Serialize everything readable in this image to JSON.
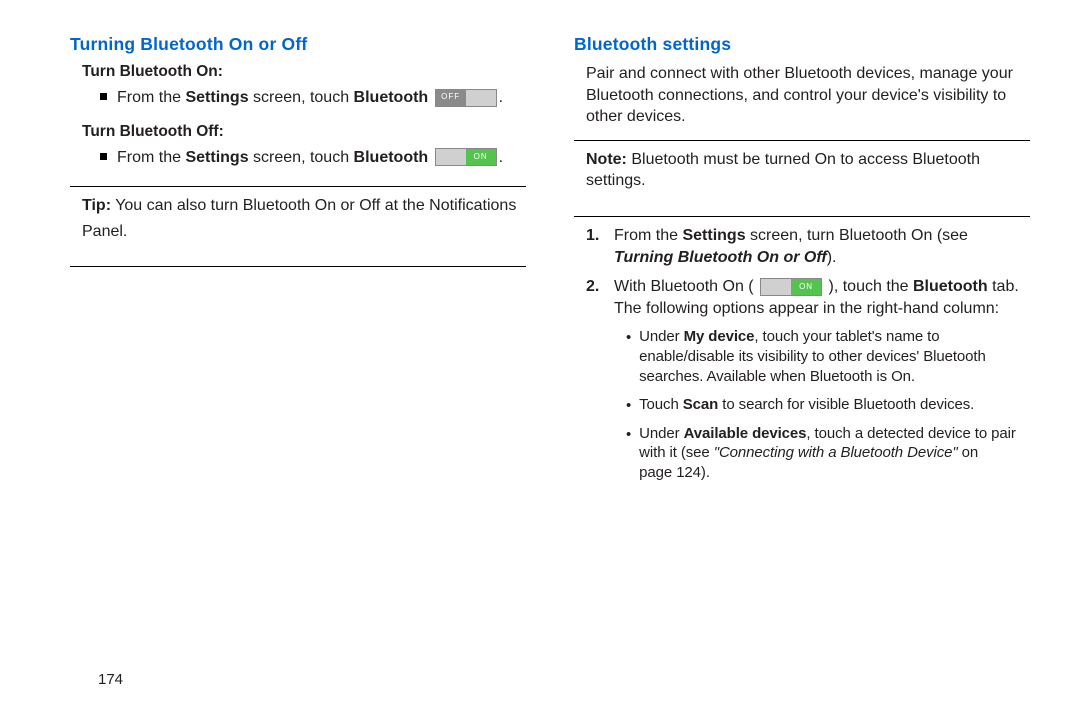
{
  "pageNumber": "174",
  "left": {
    "heading": "Turning Bluetooth On or Off",
    "turnOn": {
      "label": "Turn Bluetooth On:",
      "prefix": "From the ",
      "settings": "Settings",
      "mid": " screen, touch ",
      "bluetooth": "Bluetooth",
      "toggleLabel": "OFF",
      "period": "."
    },
    "turnOff": {
      "label": "Turn Bluetooth Off:",
      "prefix": "From the ",
      "settings": "Settings",
      "mid": " screen, touch ",
      "bluetooth": "Bluetooth",
      "toggleLabel": "ON",
      "period": "."
    },
    "tip": {
      "label": "Tip:",
      "textLine1": " You can also turn Bluetooth On or Off at the Notifications",
      "textLine2": "Panel."
    }
  },
  "right": {
    "heading": "Bluetooth settings",
    "intro": "Pair and connect with other Bluetooth devices, manage your Bluetooth connections, and control your device's visibility to other devices.",
    "note": {
      "label": "Note:",
      "text": " Bluetooth must be turned On to access Bluetooth settings."
    },
    "step1": {
      "num": "1.",
      "prefix": "From the ",
      "settings": "Settings",
      "mid": " screen, turn Bluetooth On (see ",
      "ref": "Turning Bluetooth On or Off",
      "suffix": ")."
    },
    "step2": {
      "num": "2.",
      "prefix": "With Bluetooth On ( ",
      "toggleLabel": "ON",
      "mid": " ), touch the ",
      "bluetooth": "Bluetooth",
      "suffix": " tab. The following options appear in the right-hand column:"
    },
    "sub1": {
      "prefix": "Under ",
      "bold": "My device",
      "rest": ", touch your tablet's name to enable/disable its visibility to other devices' Bluetooth searches. Available when Bluetooth is On."
    },
    "sub2": {
      "prefix": "Touch ",
      "bold": "Scan",
      "rest": " to search for visible Bluetooth devices."
    },
    "sub3": {
      "prefix": "Under ",
      "bold": "Available devices",
      "mid": ", touch a detected device to pair with it (see ",
      "italic": "\"Connecting with a Bluetooth Device\"",
      "mid2": " on ",
      "page": "page 124).",
      "pageOnlyWord": "page 124)."
    }
  }
}
